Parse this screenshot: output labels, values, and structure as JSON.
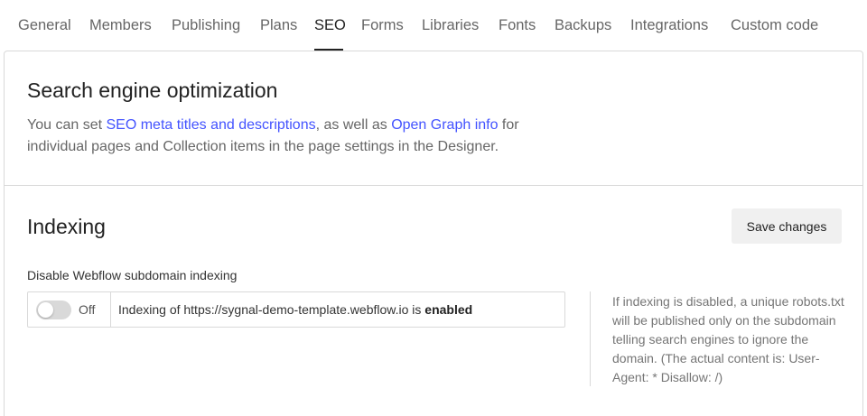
{
  "tabs": [
    {
      "label": "General"
    },
    {
      "label": "Members"
    },
    {
      "label": "Publishing"
    },
    {
      "label": "Plans"
    },
    {
      "label": "SEO",
      "active": true
    },
    {
      "label": "Forms"
    },
    {
      "label": "Libraries"
    },
    {
      "label": "Fonts"
    },
    {
      "label": "Backups"
    },
    {
      "label": "Integrations"
    },
    {
      "label": "Custom code"
    }
  ],
  "seo": {
    "title": "Search engine optimization",
    "desc_1": "You can set ",
    "link_meta": "SEO meta titles and descriptions",
    "desc_2": ", as well as ",
    "link_og": "Open Graph info",
    "desc_3": " for individual pages and Collection items in the page settings in the Designer."
  },
  "indexing": {
    "title": "Indexing",
    "save_label": "Save changes",
    "field_label": "Disable Webflow subdomain indexing",
    "toggle_state": "Off",
    "status_prefix": "Indexing of https://sygnal-demo-template.webflow.io is ",
    "status_value": "enabled",
    "help": "If indexing is disabled, a unique robots.txt will be published only on the subdomain telling search engines to ignore the domain. (The actual content is: User-Agent: * Disallow: /)"
  },
  "colors": {
    "accent_link": "#4353ff",
    "tab_active": "#222222",
    "tab_inactive": "#666666"
  }
}
